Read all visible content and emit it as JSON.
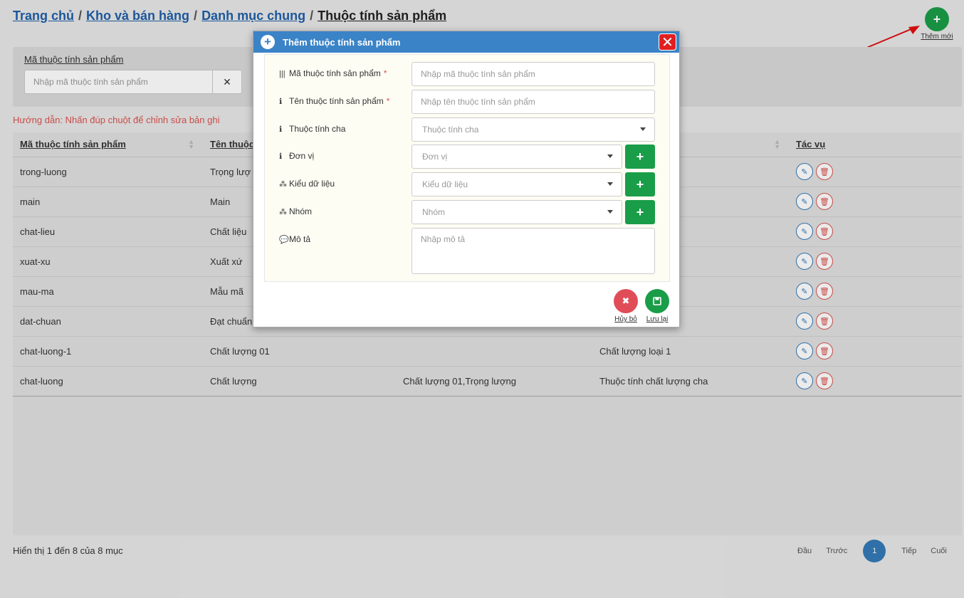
{
  "breadcrumb": {
    "home": "Trang chủ",
    "level1": "Kho và bán hàng",
    "level2": "Danh mục chung",
    "current": "Thuộc tính sản phẩm",
    "sep": "/"
  },
  "add_new": {
    "icon": "+",
    "label": "Thêm mới"
  },
  "filter": {
    "label": "Mã thuộc tính sản phẩm",
    "placeholder": "Nhập mã thuộc tính sản phẩm",
    "clear_icon": "✕"
  },
  "hint": "Hướng dẫn: Nhấn đúp chuột để chỉnh sửa bản ghi",
  "table": {
    "headers": [
      "Mã thuộc tính sản phẩm",
      "Tên thuộc",
      "",
      "",
      "Tác vụ"
    ],
    "rows": [
      [
        "trong-luong",
        "Trọng lượ",
        "",
        ""
      ],
      [
        "main",
        "Main",
        "",
        ""
      ],
      [
        "chat-lieu",
        "Chất liệu",
        "",
        ""
      ],
      [
        "xuat-xu",
        "Xuất xứ",
        "",
        ""
      ],
      [
        "mau-ma",
        "Mẫu mã",
        "",
        ""
      ],
      [
        "dat-chuan",
        "Đạt chuẩn",
        "",
        ""
      ],
      [
        "chat-luong-1",
        "Chất lượng 01",
        "",
        "Chất lượng loại 1"
      ],
      [
        "chat-luong",
        "Chất lượng",
        "Chất lượng 01,Trọng lượng",
        "Thuộc tính chất lượng cha"
      ]
    ]
  },
  "footer": {
    "showing": "Hiển thị 1 đến 8 của 8 mục",
    "first": "Đầu",
    "prev": "Trước",
    "page": "1",
    "next": "Tiếp",
    "last": "Cuối"
  },
  "modal": {
    "title": "Thêm thuộc tính sản phẩm",
    "fields": {
      "code": {
        "label": "Mã thuộc tính sản phẩm",
        "required": "*",
        "placeholder": "Nhập mã thuộc tính sản phẩm",
        "icon": "barcode-icon"
      },
      "name": {
        "label": "Tên thuộc tính sản phẩm",
        "required": "*",
        "placeholder": "Nhập tên thuộc tính sản phẩm",
        "icon": "info-icon"
      },
      "parent": {
        "label": "Thuộc tính cha",
        "placeholder": "Thuộc tính cha",
        "icon": "info-icon"
      },
      "unit": {
        "label": "Đơn vị",
        "placeholder": "Đơn vị",
        "icon": "info-icon"
      },
      "datatype": {
        "label": "Kiểu dữ liệu",
        "placeholder": "Kiểu dữ liệu",
        "icon": "cubes-icon"
      },
      "group": {
        "label": "Nhóm",
        "placeholder": "Nhóm",
        "icon": "cubes-icon"
      },
      "desc": {
        "label": "Mô tả",
        "placeholder": "Nhập mô tả",
        "icon": "comment-icon"
      }
    },
    "cancel_label": "Hủy bỏ",
    "save_label": "Lưu lại"
  },
  "colors": {
    "primary": "#3b83c7",
    "success": "#1a9d48",
    "danger": "#d9534f",
    "link": "#1f5fa8"
  }
}
